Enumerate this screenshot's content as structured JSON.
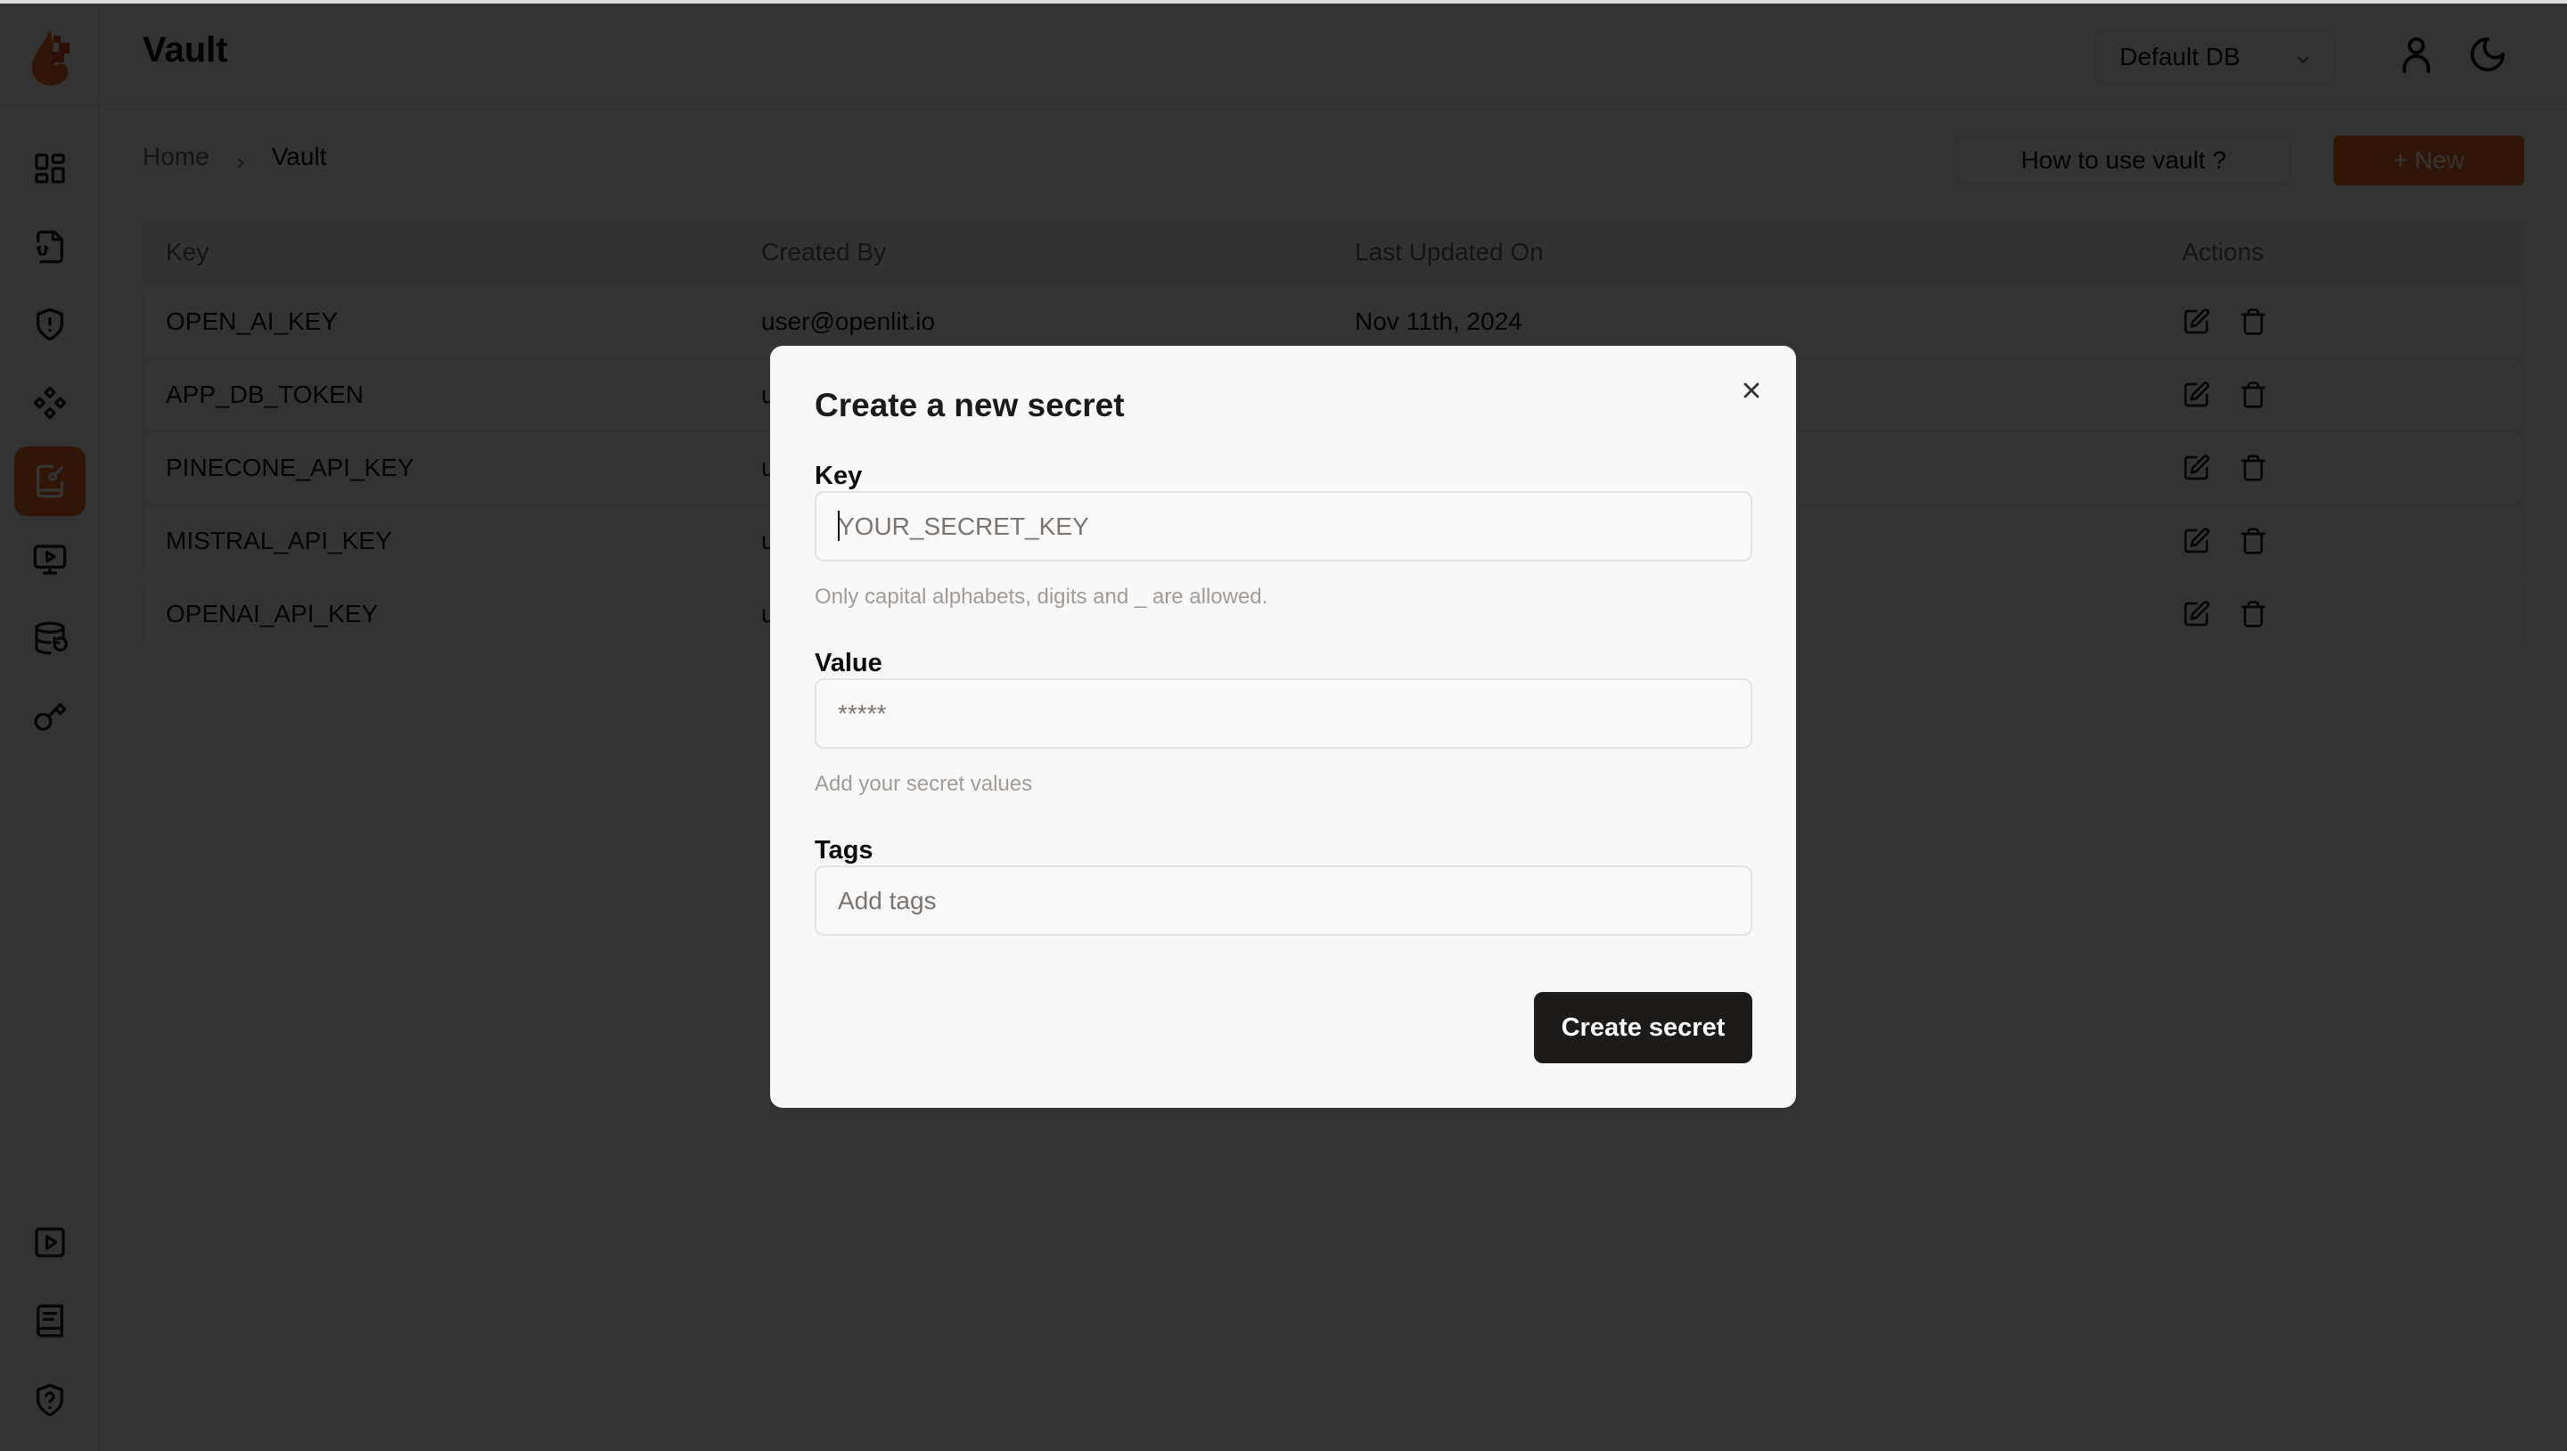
{
  "app": {
    "page_title": "Vault",
    "brand_color": "#F36C1F"
  },
  "sidebar": {
    "items": [
      {
        "name": "dashboard",
        "icon": "layout-dashboard-icon",
        "active": false
      },
      {
        "name": "requests",
        "icon": "file-code-icon",
        "active": false
      },
      {
        "name": "exceptions",
        "icon": "shield-alert-icon",
        "active": false
      },
      {
        "name": "openground",
        "icon": "components-icon",
        "active": false
      },
      {
        "name": "prompt-hub",
        "icon": "notebook-pen-icon",
        "active": true
      },
      {
        "name": "vault-monitor",
        "icon": "monitor-play-icon",
        "active": false
      },
      {
        "name": "database-config",
        "icon": "database-refresh-icon",
        "active": false
      },
      {
        "name": "api-keys",
        "icon": "key-icon",
        "active": false
      }
    ],
    "bottom_items": [
      {
        "name": "videos",
        "icon": "square-play-icon"
      },
      {
        "name": "docs",
        "icon": "book-icon"
      },
      {
        "name": "help",
        "icon": "shield-question-icon"
      }
    ]
  },
  "header": {
    "db_selector": {
      "selected": "Default DB"
    },
    "user_icon": "user-icon",
    "theme_icon": "moon-icon"
  },
  "breadcrumb": {
    "home": "Home",
    "current": "Vault"
  },
  "toolbar": {
    "how_to_label": "How to use vault ?",
    "new_label": "+ New"
  },
  "table": {
    "columns": [
      "Key",
      "Created By",
      "Last Updated On",
      "Actions"
    ],
    "rows": [
      {
        "key": "OPEN_AI_KEY",
        "created_by": "user@openlit.io",
        "updated": "Nov 11th, 2024"
      },
      {
        "key": "APP_DB_TOKEN",
        "created_by": "u",
        "updated": ""
      },
      {
        "key": "PINECONE_API_KEY",
        "created_by": "u",
        "updated": ""
      },
      {
        "key": "MISTRAL_API_KEY",
        "created_by": "u",
        "updated": ""
      },
      {
        "key": "OPENAI_API_KEY",
        "created_by": "u",
        "updated": ""
      }
    ]
  },
  "modal": {
    "title": "Create a new secret",
    "key": {
      "label": "Key",
      "value": "",
      "placeholder": "YOUR_SECRET_KEY",
      "helper": "Only capital alphabets, digits and _ are allowed."
    },
    "value": {
      "label": "Value",
      "value": "",
      "placeholder": "*****",
      "helper": "Add your secret values"
    },
    "tags": {
      "label": "Tags",
      "value": "",
      "placeholder": "Add tags"
    },
    "submit_label": "Create secret"
  }
}
